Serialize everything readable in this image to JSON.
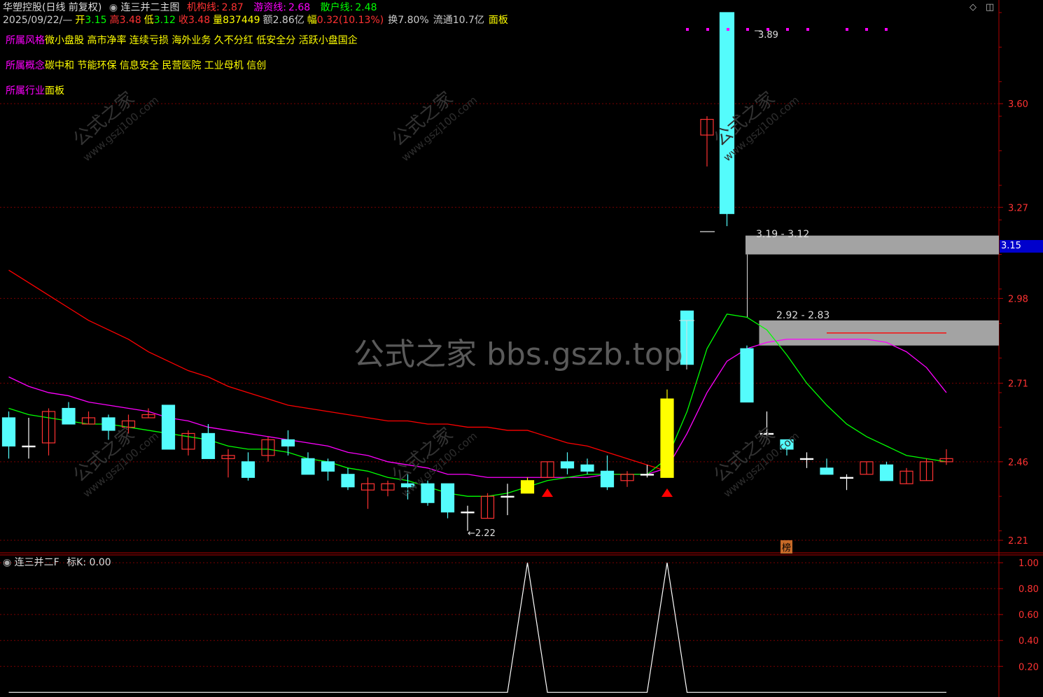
{
  "header": {
    "stock": "华塑控股(日线 前复权)",
    "indicator": "连三并二主图",
    "inst_label": "机构线:",
    "inst_val": "2.87",
    "hot_label": "游资线:",
    "hot_val": "2.68",
    "retail_label": "散户线:",
    "retail_val": "2.48",
    "date": "2025/09/22/—",
    "open_label": "开",
    "open": "3.15",
    "high_label": "高",
    "high": "3.48",
    "low_label": "低",
    "low": "3.12",
    "close_label": "收",
    "close": "3.48",
    "vol_label": "量",
    "vol": "837449",
    "amt_label": "额",
    "amt": "2.86亿",
    "chg_label": "幅",
    "chg": "0.32(10.13%)",
    "turnover": "换7.80%",
    "float": "流通10.7亿",
    "board": "面板"
  },
  "tags": {
    "style_label": "所属风格",
    "style_val": "微小盘股 高市净率 连续亏损 海外业务 久不分红 低安全分 活跃小盘国企",
    "concept_label": "所属概念",
    "concept_val": "碳中和 节能环保 信息安全 民营医院 工业母机 信创",
    "industry_label": "所属行业",
    "industry_val": "面板"
  },
  "annotations": {
    "high": "3.89",
    "low": "←2.22",
    "zone1": "3.19 - 3.12",
    "zone2": "2.92 - 2.83",
    "bang": "榜",
    "price_tag": "3.15"
  },
  "watermark": {
    "center": "公式之家 bbs.gszb.top",
    "tile_cn": "公式之家",
    "tile_url": "www.gszj100.com"
  },
  "sub": {
    "title": "连三并二F",
    "value": "标K: 0.00"
  },
  "colors": {
    "up": "#ff3232",
    "down": "#54fcfc",
    "signal": "#ffff00",
    "inst": "#ff0000",
    "hot": "#ff00ff",
    "retail": "#00ff00"
  },
  "chart_data": [
    {
      "type": "candlestick",
      "yticks": [
        "3.60",
        "3.27",
        "2.98",
        "2.71",
        "2.46",
        "2.21"
      ],
      "ylim": [
        2.17,
        3.93
      ],
      "candles": [
        {
          "o": 2.6,
          "h": 2.62,
          "l": 2.47,
          "c": 2.51
        },
        {
          "o": 2.51,
          "h": 2.6,
          "l": 2.47,
          "c": 2.51
        },
        {
          "o": 2.52,
          "h": 2.63,
          "l": 2.48,
          "c": 2.62
        },
        {
          "o": 2.63,
          "h": 2.65,
          "l": 2.58,
          "c": 2.58
        },
        {
          "o": 2.58,
          "h": 2.62,
          "l": 2.58,
          "c": 2.6
        },
        {
          "o": 2.6,
          "h": 2.61,
          "l": 2.53,
          "c": 2.56
        },
        {
          "o": 2.57,
          "h": 2.61,
          "l": 2.55,
          "c": 2.59
        },
        {
          "o": 2.6,
          "h": 2.63,
          "l": 2.6,
          "c": 2.61
        },
        {
          "o": 2.64,
          "h": 2.64,
          "l": 2.5,
          "c": 2.5
        },
        {
          "o": 2.5,
          "h": 2.56,
          "l": 2.48,
          "c": 2.55
        },
        {
          "o": 2.55,
          "h": 2.58,
          "l": 2.47,
          "c": 2.47
        },
        {
          "o": 2.47,
          "h": 2.5,
          "l": 2.41,
          "c": 2.48
        },
        {
          "o": 2.46,
          "h": 2.49,
          "l": 2.4,
          "c": 2.41
        },
        {
          "o": 2.48,
          "h": 2.54,
          "l": 2.46,
          "c": 2.53
        },
        {
          "o": 2.53,
          "h": 2.56,
          "l": 2.48,
          "c": 2.51
        },
        {
          "o": 2.47,
          "h": 2.49,
          "l": 2.42,
          "c": 2.42
        },
        {
          "o": 2.46,
          "h": 2.47,
          "l": 2.4,
          "c": 2.43
        },
        {
          "o": 2.42,
          "h": 2.44,
          "l": 2.37,
          "c": 2.38
        },
        {
          "o": 2.37,
          "h": 2.41,
          "l": 2.31,
          "c": 2.39
        },
        {
          "o": 2.37,
          "h": 2.4,
          "l": 2.35,
          "c": 2.39
        },
        {
          "o": 2.39,
          "h": 2.42,
          "l": 2.34,
          "c": 2.38
        },
        {
          "o": 2.39,
          "h": 2.4,
          "l": 2.32,
          "c": 2.33
        },
        {
          "o": 2.39,
          "h": 2.39,
          "l": 2.28,
          "c": 2.3
        },
        {
          "o": 2.3,
          "h": 2.32,
          "l": 2.24,
          "c": 2.3
        },
        {
          "o": 2.28,
          "h": 2.36,
          "l": 2.28,
          "c": 2.35
        },
        {
          "o": 2.35,
          "h": 2.39,
          "l": 2.29,
          "c": 2.35
        },
        {
          "o": 2.36,
          "h": 2.41,
          "l": 2.36,
          "c": 2.4
        },
        {
          "o": 2.41,
          "h": 2.46,
          "l": 2.41,
          "c": 2.46
        },
        {
          "o": 2.46,
          "h": 2.49,
          "l": 2.42,
          "c": 2.44
        },
        {
          "o": 2.45,
          "h": 2.47,
          "l": 2.42,
          "c": 2.43
        },
        {
          "o": 2.43,
          "h": 2.48,
          "l": 2.37,
          "c": 2.38
        },
        {
          "o": 2.4,
          "h": 2.43,
          "l": 2.38,
          "c": 2.42
        },
        {
          "o": 2.42,
          "h": 2.45,
          "l": 2.41,
          "c": 2.42
        },
        {
          "o": 2.41,
          "h": 2.69,
          "l": 2.41,
          "c": 2.66
        },
        {
          "o": 2.94,
          "h": 2.94,
          "l": 2.77,
          "c": 2.77
        },
        {
          "o": 3.5,
          "h": 3.56,
          "l": 3.4,
          "c": 3.55
        },
        {
          "o": 3.89,
          "h": 3.89,
          "l": 3.21,
          "c": 3.25
        },
        {
          "o": 2.82,
          "h": 2.83,
          "l": 2.65,
          "c": 2.65
        },
        {
          "o": 2.55,
          "h": 2.62,
          "l": 2.53,
          "c": 2.55
        },
        {
          "o": 2.53,
          "h": 2.53,
          "l": 2.48,
          "c": 2.5
        },
        {
          "o": 2.47,
          "h": 2.49,
          "l": 2.44,
          "c": 2.47
        },
        {
          "o": 2.44,
          "h": 2.47,
          "l": 2.42,
          "c": 2.42
        },
        {
          "o": 2.41,
          "h": 2.42,
          "l": 2.37,
          "c": 2.41
        },
        {
          "o": 2.42,
          "h": 2.46,
          "l": 2.42,
          "c": 2.46
        },
        {
          "o": 2.45,
          "h": 2.46,
          "l": 2.4,
          "c": 2.4
        },
        {
          "o": 2.39,
          "h": 2.44,
          "l": 2.39,
          "c": 2.43
        },
        {
          "o": 2.4,
          "h": 2.47,
          "l": 2.4,
          "c": 2.46
        },
        {
          "o": 2.46,
          "h": 2.5,
          "l": 2.45,
          "c": 2.47
        }
      ],
      "signal_bars": [
        26,
        33
      ],
      "arrows": [
        27,
        33
      ],
      "lines": [
        {
          "name": "机构线",
          "color": "#ff0000",
          "values": [
            3.07,
            3.03,
            2.99,
            2.95,
            2.91,
            2.88,
            2.85,
            2.81,
            2.78,
            2.75,
            2.73,
            2.7,
            2.68,
            2.66,
            2.64,
            2.63,
            2.62,
            2.61,
            2.6,
            2.59,
            2.59,
            2.58,
            2.58,
            2.57,
            2.57,
            2.56,
            2.56,
            2.54,
            2.52,
            2.51,
            2.49,
            2.47,
            2.45,
            2.43
          ]
        },
        {
          "name": "游资线",
          "color": "#ff00ff",
          "values": [
            2.73,
            2.7,
            2.68,
            2.67,
            2.65,
            2.64,
            2.63,
            2.62,
            2.6,
            2.59,
            2.57,
            2.56,
            2.55,
            2.54,
            2.53,
            2.52,
            2.51,
            2.49,
            2.48,
            2.46,
            2.45,
            2.44,
            2.42,
            2.42,
            2.41,
            2.41,
            2.41,
            2.41,
            2.41,
            2.41,
            2.42,
            2.42,
            2.42,
            2.44,
            2.55,
            2.68,
            2.78,
            2.82,
            2.84,
            2.85,
            2.85,
            2.85,
            2.85,
            2.85,
            2.84,
            2.81,
            2.76,
            2.68
          ]
        },
        {
          "name": "散户线",
          "color": "#00ff00",
          "values": [
            2.63,
            2.61,
            2.6,
            2.59,
            2.58,
            2.58,
            2.57,
            2.56,
            2.55,
            2.54,
            2.53,
            2.51,
            2.5,
            2.5,
            2.49,
            2.47,
            2.46,
            2.44,
            2.43,
            2.41,
            2.4,
            2.38,
            2.36,
            2.35,
            2.35,
            2.36,
            2.38,
            2.4,
            2.41,
            2.42,
            2.42,
            2.42,
            2.42,
            2.47,
            2.62,
            2.82,
            2.93,
            2.92,
            2.88,
            2.8,
            2.71,
            2.64,
            2.58,
            2.54,
            2.51,
            2.48,
            2.47,
            2.46
          ]
        },
        {
          "name": "机构线-end",
          "color": "#ff0000",
          "values": [
            2.87,
            2.87,
            2.87,
            2.87,
            2.87,
            2.87,
            2.87
          ]
        }
      ]
    },
    {
      "type": "line",
      "name": "标K",
      "yticks": [
        "1.00",
        "0.80",
        "0.60",
        "0.40",
        "0.20"
      ],
      "ylim": [
        -0.02,
        1.06
      ],
      "values": [
        0,
        0,
        0,
        0,
        0,
        0,
        0,
        0,
        0,
        0,
        0,
        0,
        0,
        0,
        0,
        0,
        0,
        0,
        0,
        0,
        0,
        0,
        0,
        0,
        0,
        0,
        1,
        0,
        0,
        0,
        0,
        0,
        0,
        1,
        0,
        0,
        0,
        0,
        0,
        0,
        0,
        0,
        0,
        0,
        0,
        0,
        0,
        0
      ]
    }
  ]
}
